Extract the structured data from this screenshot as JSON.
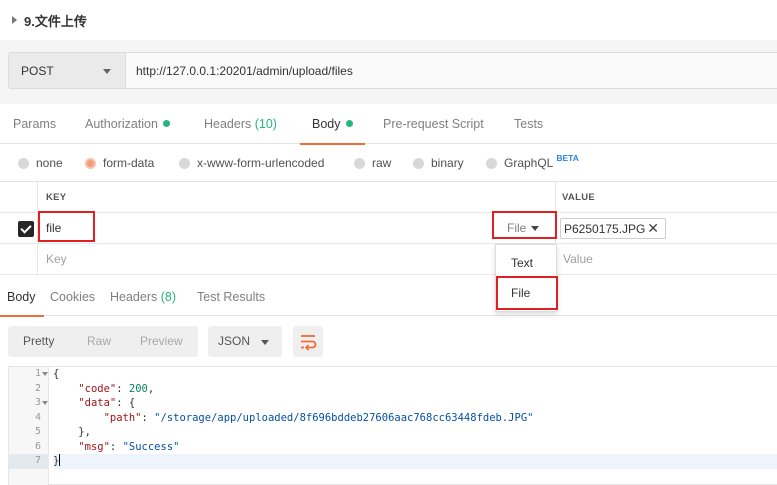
{
  "request": {
    "title": "9.文件上传",
    "method": "POST",
    "url": "http://127.0.0.1:20201/admin/upload/files"
  },
  "request_tabs": [
    {
      "label": "Params"
    },
    {
      "label": "Authorization",
      "dot": true
    },
    {
      "label": "Headers",
      "count": "(10)"
    },
    {
      "label": "Body",
      "dot": true,
      "active": true
    },
    {
      "label": "Pre-request Script"
    },
    {
      "label": "Tests"
    }
  ],
  "body_types": {
    "none": "none",
    "form_data": "form-data",
    "urlencoded": "x-www-form-urlencoded",
    "raw": "raw",
    "binary": "binary",
    "graphql": "GraphQL",
    "graphql_badge": "BETA",
    "selected": "form-data"
  },
  "kv_table": {
    "key_header": "KEY",
    "value_header": "VALUE",
    "row1": {
      "key": "file",
      "type": "File",
      "value": "P6250175.JPG",
      "checked": true
    },
    "row2": {
      "key_placeholder": "Key",
      "value_placeholder": "Value"
    }
  },
  "type_menu": {
    "option_text": "Text",
    "option_file": "File"
  },
  "response_tabs": [
    {
      "label": "Body",
      "active": true
    },
    {
      "label": "Cookies"
    },
    {
      "label": "Headers",
      "count": "(8)"
    },
    {
      "label": "Test Results"
    }
  ],
  "view": {
    "pretty": "Pretty",
    "raw": "Raw",
    "preview": "Preview",
    "format": "JSON"
  },
  "response_lines": [
    "1",
    "2",
    "3",
    "4",
    "5",
    "6",
    "7"
  ],
  "response_json": {
    "open": "{",
    "code_key": "\"code\"",
    "code_val": "200",
    "data_key": "\"data\"",
    "data_open": "{",
    "path_key": "\"path\"",
    "path_val": "\"/storage/app/uploaded/8f696bddeb27606aac768cc63448fdeb.JPG\"",
    "data_close": "},",
    "msg_key": "\"msg\"",
    "msg_val": "\"Success\"",
    "close": "}"
  },
  "colors": {
    "accent": "#f26b3a",
    "green": "#26b47f",
    "highlight_red": "#e02020",
    "beta_blue": "#2e86de"
  }
}
